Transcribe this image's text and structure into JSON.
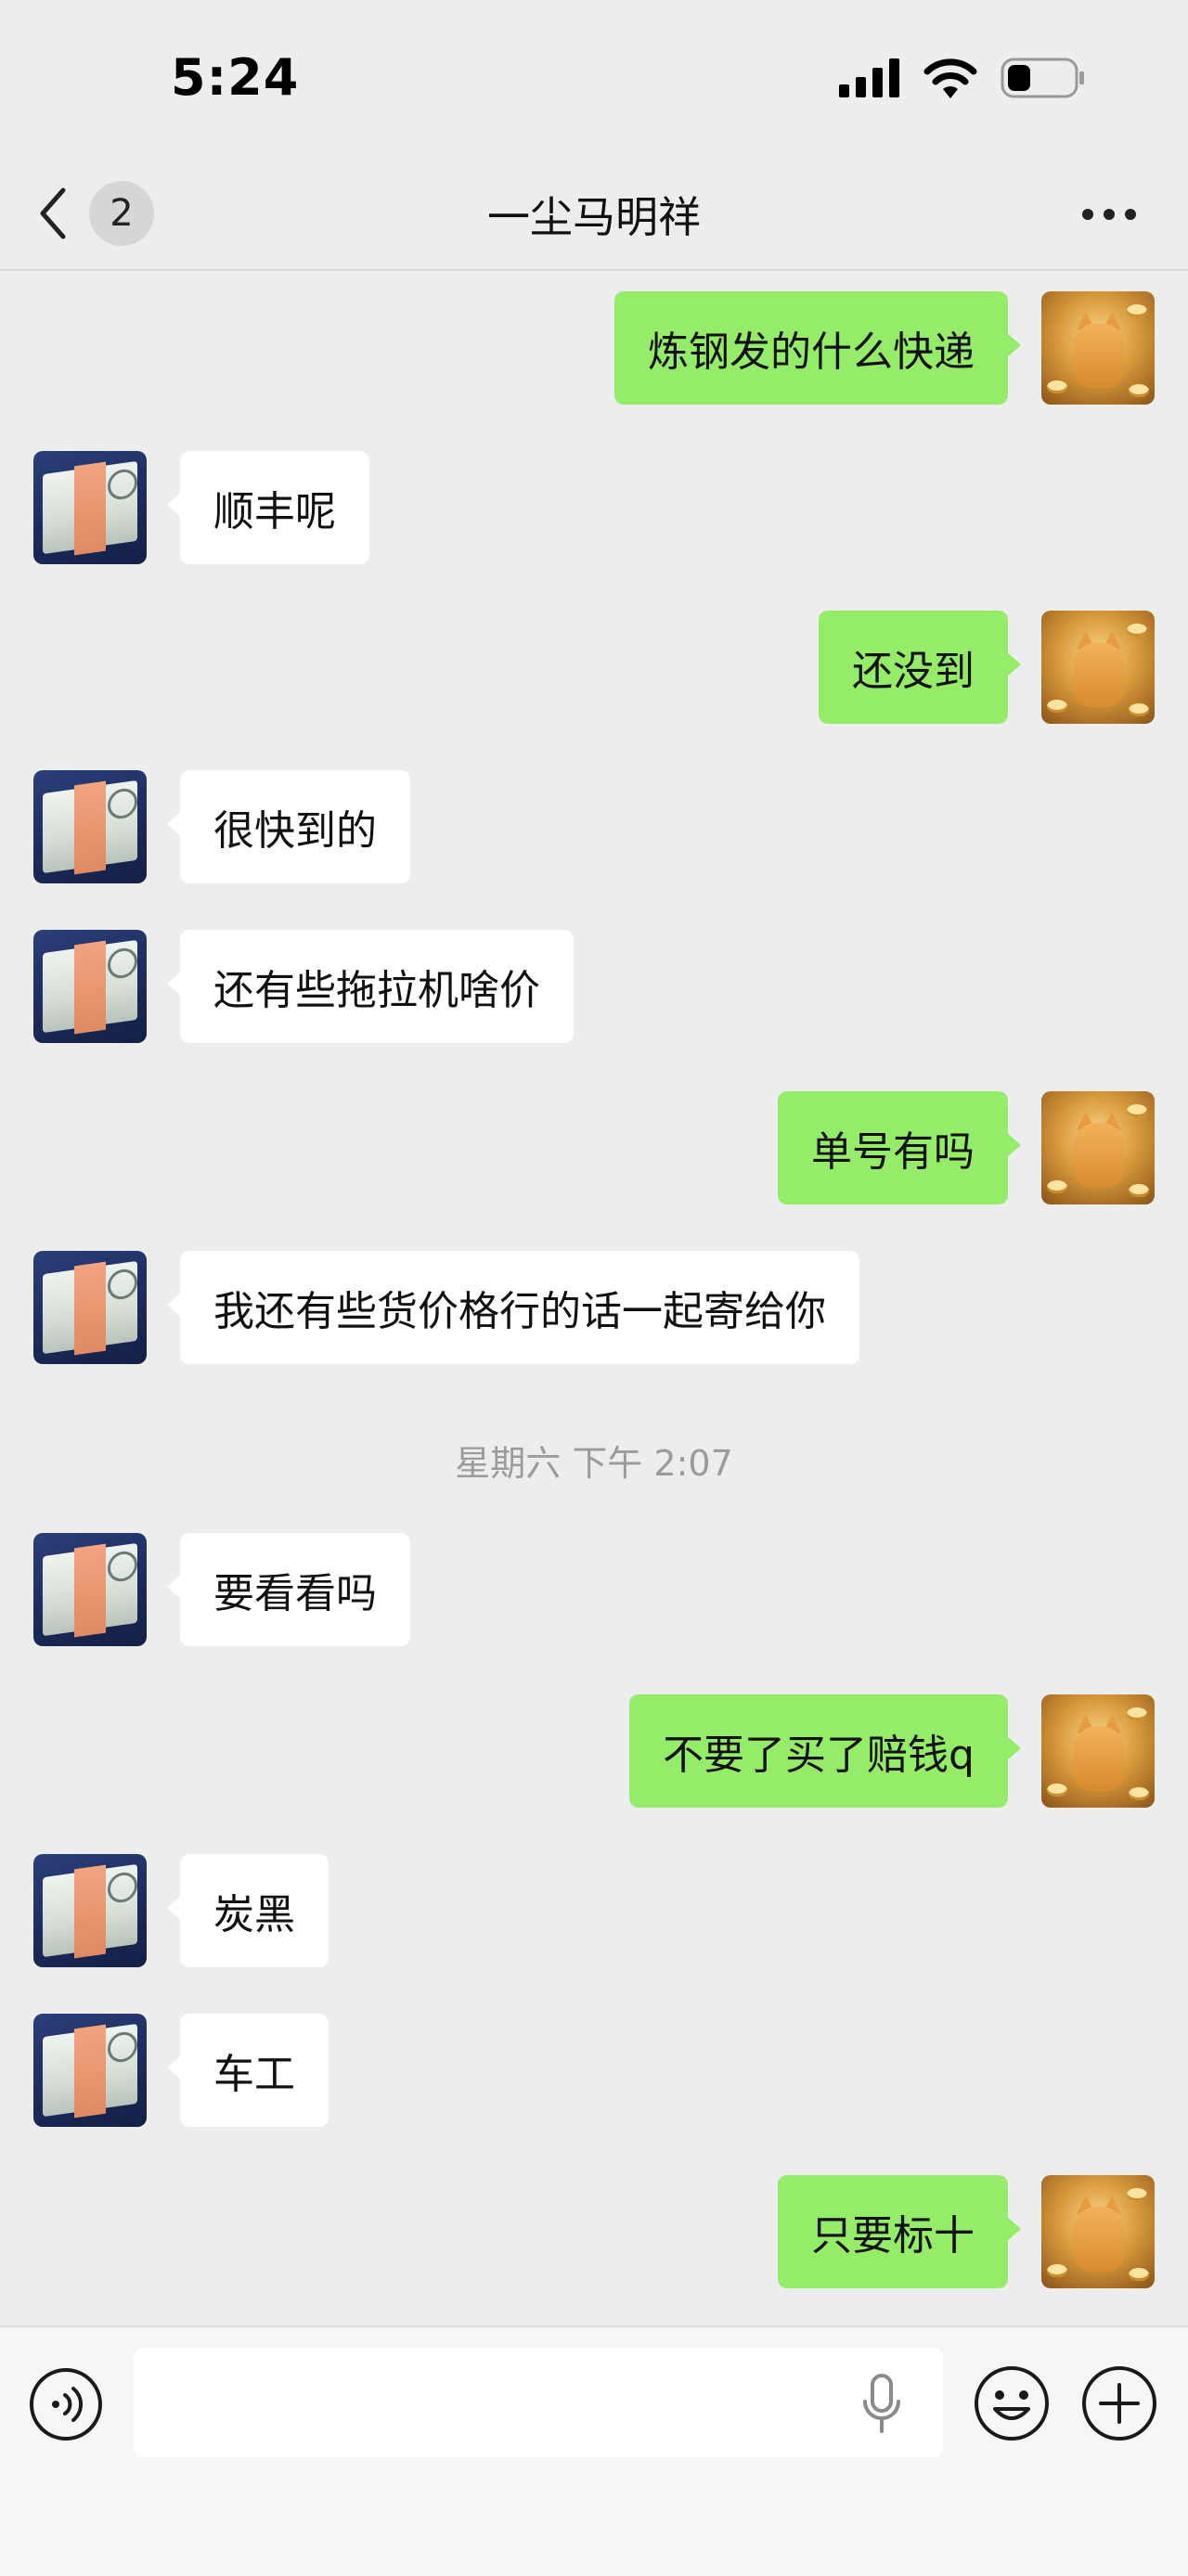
{
  "status_bar": {
    "time": "5:24",
    "icons": [
      "signal-icon",
      "wifi-icon",
      "battery-icon"
    ]
  },
  "header": {
    "back_icon": "chevron-left-icon",
    "unread_count": "2",
    "title": "一尘马明祥",
    "more_icon": "more-dots-icon"
  },
  "colors": {
    "background": "#ededed",
    "outgoing_bubble": "#95ec69",
    "incoming_bubble": "#ffffff",
    "timestamp_text": "#9b9b9b"
  },
  "messages": [
    {
      "direction": "out",
      "text": "炼钢发的什么快递"
    },
    {
      "direction": "in",
      "text": "顺丰呢"
    },
    {
      "direction": "out",
      "text": "还没到"
    },
    {
      "direction": "in",
      "text": "很快到的"
    },
    {
      "direction": "in",
      "text": "还有些拖拉机啥价"
    },
    {
      "direction": "out",
      "text": "单号有吗"
    },
    {
      "direction": "in",
      "text": "我还有些货价格行的话一起寄给你"
    },
    {
      "direction": "in",
      "text": "要看看吗"
    },
    {
      "direction": "out",
      "text": "不要了买了赔钱q"
    },
    {
      "direction": "in",
      "text": "炭黑"
    },
    {
      "direction": "in",
      "text": "车工"
    },
    {
      "direction": "out",
      "text": "只要标十"
    }
  ],
  "timestamp": "星期六 下午 2:07",
  "input_bar": {
    "voice_icon": "voice-mode-icon",
    "text_value": "",
    "mic_icon": "microphone-icon",
    "emoji_icon": "emoji-icon",
    "plus_icon": "plus-circle-icon"
  }
}
